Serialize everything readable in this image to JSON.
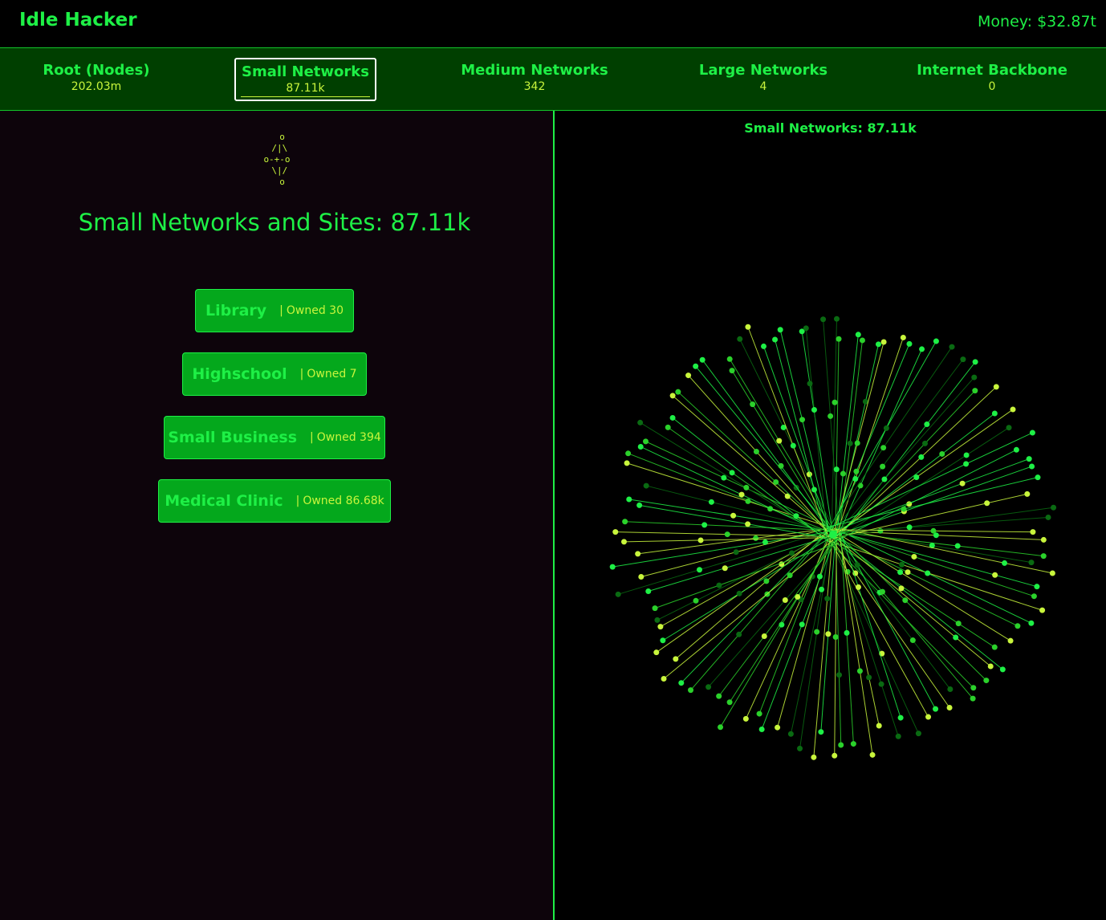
{
  "app": {
    "title": "Idle Hacker",
    "money": "Money: $32.87t"
  },
  "tabs": [
    {
      "label": "Root (Nodes)",
      "count": "202.03m",
      "active": false
    },
    {
      "label": "Small Networks",
      "count": "87.11k",
      "active": true
    },
    {
      "label": "Medium Networks",
      "count": "342",
      "active": false
    },
    {
      "label": "Large Networks",
      "count": "4",
      "active": false
    },
    {
      "label": "Internet Backbone",
      "count": "0",
      "active": false
    }
  ],
  "left": {
    "ascii_art": "  o\n /|\\\no-+-o\n \\|/\n  o",
    "title": "Small Networks and Sites: 87.11k",
    "items": [
      {
        "name": "Library",
        "owned": "Owned 30"
      },
      {
        "name": "Highschool",
        "owned": "Owned 7"
      },
      {
        "name": "Small Business",
        "owned": "Owned 394"
      },
      {
        "name": "Medical Clinic",
        "owned": "Owned 86.68k"
      }
    ],
    "separator": "|"
  },
  "right": {
    "title": "Small Networks: 87.11k"
  },
  "colors": {
    "accent": "#1ef046",
    "highlight": "#c8f53c",
    "tab_bar": "#003f00",
    "button": "#04a81c",
    "panel_left": "#0d040b",
    "node_dark": "#0a6a12"
  }
}
